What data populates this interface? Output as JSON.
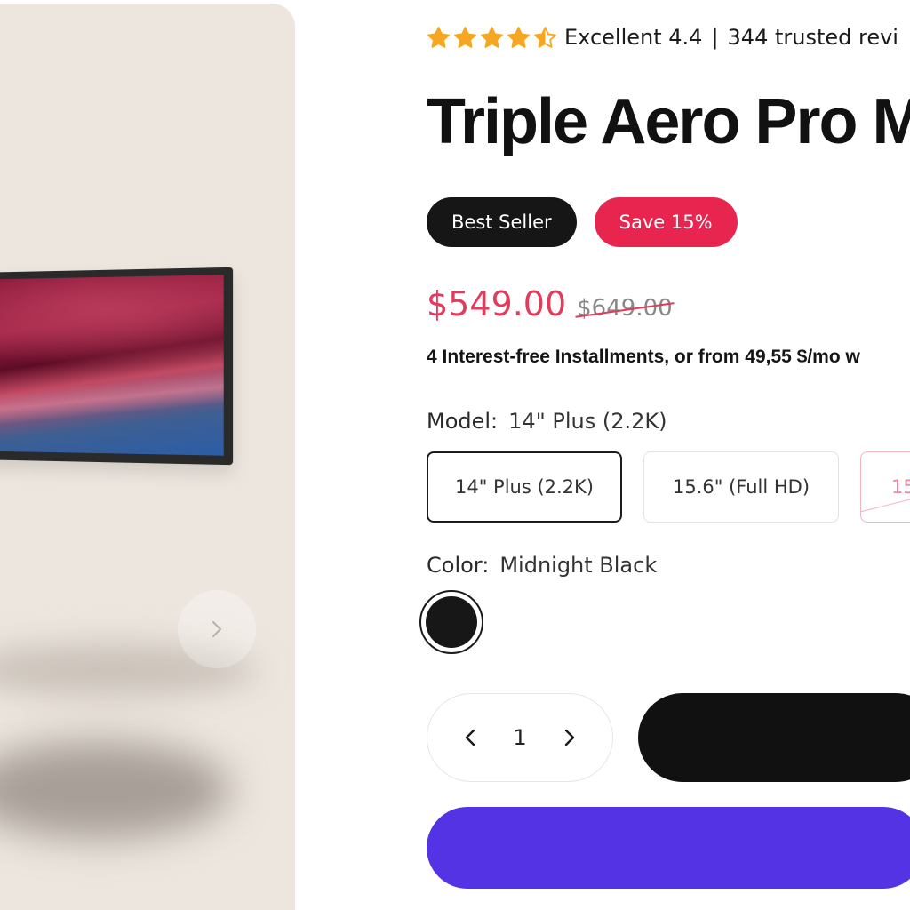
{
  "rating": {
    "stars_value": 4.5,
    "stars_max": 5,
    "label": "Excellent 4.4",
    "separator": "|",
    "reviews_text": "344 trusted revi"
  },
  "product": {
    "title": "Triple Aero Pro M"
  },
  "badges": {
    "best_seller": "Best Seller",
    "save": "Save 15%"
  },
  "price": {
    "current": "$549.00",
    "original": "$649.00"
  },
  "installments_text": "4 Interest-free Installments, or from 49,55 $/mo w",
  "model": {
    "label": "Model:",
    "selected": "14\" Plus (2.2K)",
    "options": [
      {
        "label": "14\" Plus (2.2K)",
        "state": "selected"
      },
      {
        "label": "15.6\" (Full HD)",
        "state": "available"
      },
      {
        "label": "15.",
        "state": "sold-out"
      }
    ]
  },
  "color": {
    "label": "Color:",
    "selected": "Midnight Black",
    "swatches": [
      {
        "name": "Midnight Black",
        "hex": "#171717"
      }
    ]
  },
  "quantity": {
    "value": "1"
  },
  "colors": {
    "accent_sale": "#e8254f",
    "price": "#e23b5c",
    "buy_button": "#5333e3",
    "cart_button": "#111111",
    "star": "#f5a623",
    "image_bg": "#ede6df"
  },
  "icons": {
    "gallery_next": "chevron-right-icon",
    "qty_decrease": "chevron-left-icon",
    "qty_increase": "chevron-right-icon",
    "star": "star-icon"
  }
}
